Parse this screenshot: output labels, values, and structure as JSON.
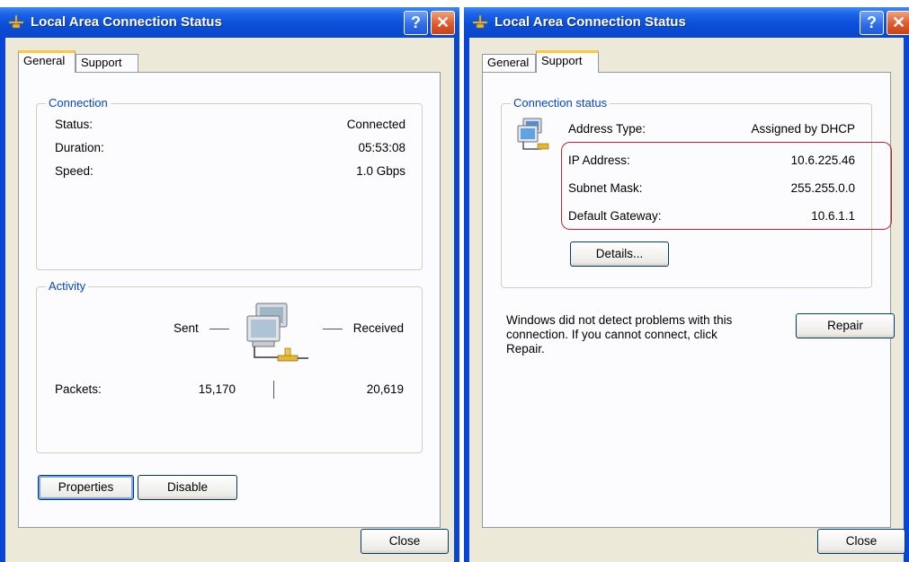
{
  "left_window": {
    "title": "Local Area Connection Status",
    "help_label": "?",
    "close_label": "✕",
    "tabs": [
      "General",
      "Support"
    ],
    "active_tab": "General",
    "connection": {
      "group_label": "Connection",
      "rows": [
        {
          "label": "Status:",
          "value": "Connected"
        },
        {
          "label": "Duration:",
          "value": "05:53:08"
        },
        {
          "label": "Speed:",
          "value": "1.0 Gbps"
        }
      ]
    },
    "activity": {
      "group_label": "Activity",
      "sent_label": "Sent",
      "received_label": "Received",
      "packets_label": "Packets:",
      "sent_value": "15,170",
      "received_value": "20,619"
    },
    "buttons": {
      "properties": "Properties",
      "disable": "Disable",
      "close": "Close"
    }
  },
  "right_window": {
    "title": "Local Area Connection Status",
    "help_label": "?",
    "close_label": "✕",
    "tabs": [
      "General",
      "Support"
    ],
    "active_tab": "Support",
    "connection_status": {
      "group_label": "Connection status",
      "rows": [
        {
          "label": "Address Type:",
          "value": "Assigned by DHCP"
        },
        {
          "label": "IP Address:",
          "value": "10.6.225.46"
        },
        {
          "label": "Subnet Mask:",
          "value": "255.255.0.0"
        },
        {
          "label": "Default Gateway:",
          "value": "10.6.1.1"
        }
      ],
      "details_button": "Details..."
    },
    "repair_message": [
      "Windows did not detect problems with this",
      "connection. If you cannot connect, click",
      "Repair."
    ],
    "buttons": {
      "repair": "Repair",
      "close": "Close"
    }
  },
  "colors": {
    "titlebar_blue": "#0a46d6",
    "group_label_blue": "#0046d5",
    "highlight_red": "#c8202f",
    "dialog_background": "#ece9d8"
  },
  "icons": [
    "network-connection-icon",
    "help-icon",
    "close-icon",
    "network-computers-icon"
  ]
}
